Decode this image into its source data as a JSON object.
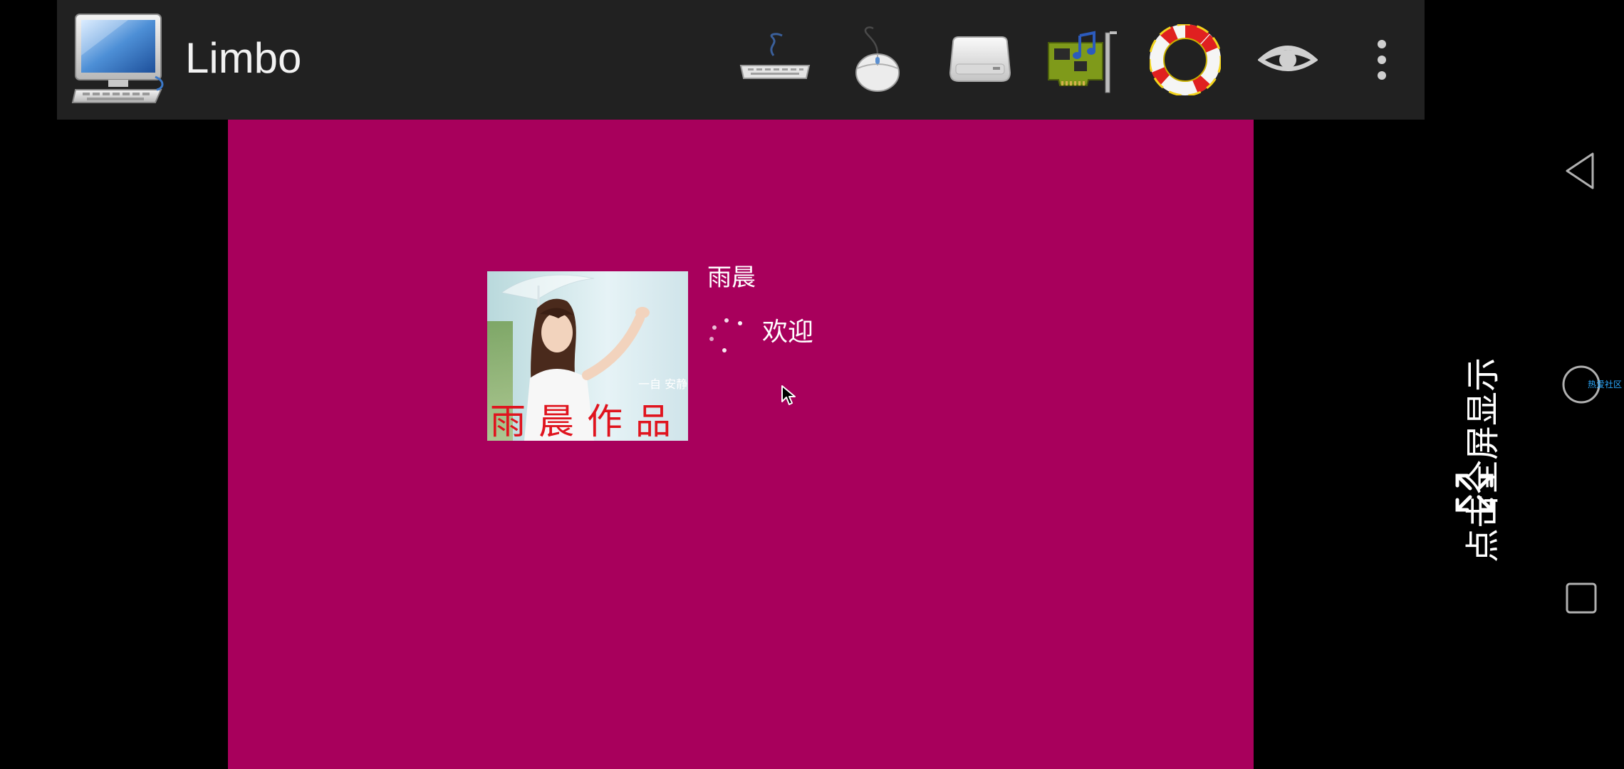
{
  "app": {
    "title": "Limbo",
    "icon": "computer-icon"
  },
  "toolbar": {
    "buttons": [
      {
        "name": "keyboard",
        "icon": "keyboard-icon"
      },
      {
        "name": "mouse",
        "icon": "mouse-icon"
      },
      {
        "name": "drive",
        "icon": "removable-drive-icon"
      },
      {
        "name": "audio",
        "icon": "sound-card-icon"
      },
      {
        "name": "help",
        "icon": "lifebuoy-icon"
      },
      {
        "name": "view",
        "icon": "eye-icon"
      },
      {
        "name": "overflow",
        "icon": "more-vertical-icon"
      }
    ]
  },
  "vm_screen": {
    "background_color": "#a8005c",
    "user_name": "雨晨",
    "status_text": "欢迎",
    "avatar": {
      "caption": "雨晨作品",
      "overlay_text": "一自 安静"
    }
  },
  "fullscreen_hint": {
    "label": "点击全屏显示",
    "icon": "expand-icon"
  },
  "navigation": {
    "back": "back-triangle-icon",
    "home": "home-circle-icon",
    "recent": "recent-square-icon",
    "watermark": "热爱社区"
  },
  "colors": {
    "toolbar_bg": "#212121",
    "vm_bg": "#a8005c",
    "caption_red": "#e0141e",
    "watermark_blue": "#2aa9ff"
  }
}
